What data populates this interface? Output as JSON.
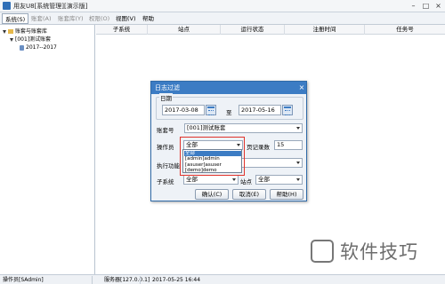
{
  "window": {
    "title": "用友U8[系统管理][演示版]",
    "controls": {
      "minimize": "–",
      "maximize": "□",
      "close": "×"
    }
  },
  "menubar": {
    "items": [
      {
        "label": "系统(S)",
        "state": "active"
      },
      {
        "label": "账套(A)",
        "state": "disabled"
      },
      {
        "label": "账套库(Y)",
        "state": "disabled"
      },
      {
        "label": "权限(O)",
        "state": "disabled"
      },
      {
        "label": "视图(V)",
        "state": "normal"
      },
      {
        "label": "帮助",
        "state": "normal"
      }
    ]
  },
  "tree": {
    "root": "账套与账套库",
    "account": "[001]测试账套",
    "year": "2017--2017"
  },
  "grid": {
    "columns": [
      "子系统",
      "站点",
      "运行状态",
      "注册时间",
      "任务号"
    ]
  },
  "dialog": {
    "title": "日志过滤",
    "close": "×",
    "date_group_title": "日期",
    "date_from": "2017-03-08",
    "date_to_label": "至",
    "date_to": "2017-05-16",
    "account_label": "账套号",
    "account_value": "[001]测试账套",
    "operator_label": "操作员",
    "operator_value": "全部",
    "page_records_label": "页记录数",
    "page_records_value": "15",
    "function_label": "执行功能",
    "subsystem_label": "子系统",
    "subsystem_value": "全部",
    "site_label": "站点",
    "site_value": "全部",
    "confirm_button": "确认(C)",
    "cancel_button": "取消(E)",
    "help_button": "帮助(H)",
    "operator_options": [
      "全部",
      "[admin]admin",
      "[asuser]asuser",
      "[demo]demo"
    ]
  },
  "statusbar": {
    "operator": "操作员[SAdmin]",
    "server": "服务器[127.0.0.1]",
    "datetime": "2017-05-25 16:44"
  },
  "watermark": {
    "text": "软件技巧"
  },
  "colors": {
    "dialog_title_bg": "#3c7cc4",
    "highlight_box": "#e0322b",
    "selection": "#3c7cc4"
  }
}
